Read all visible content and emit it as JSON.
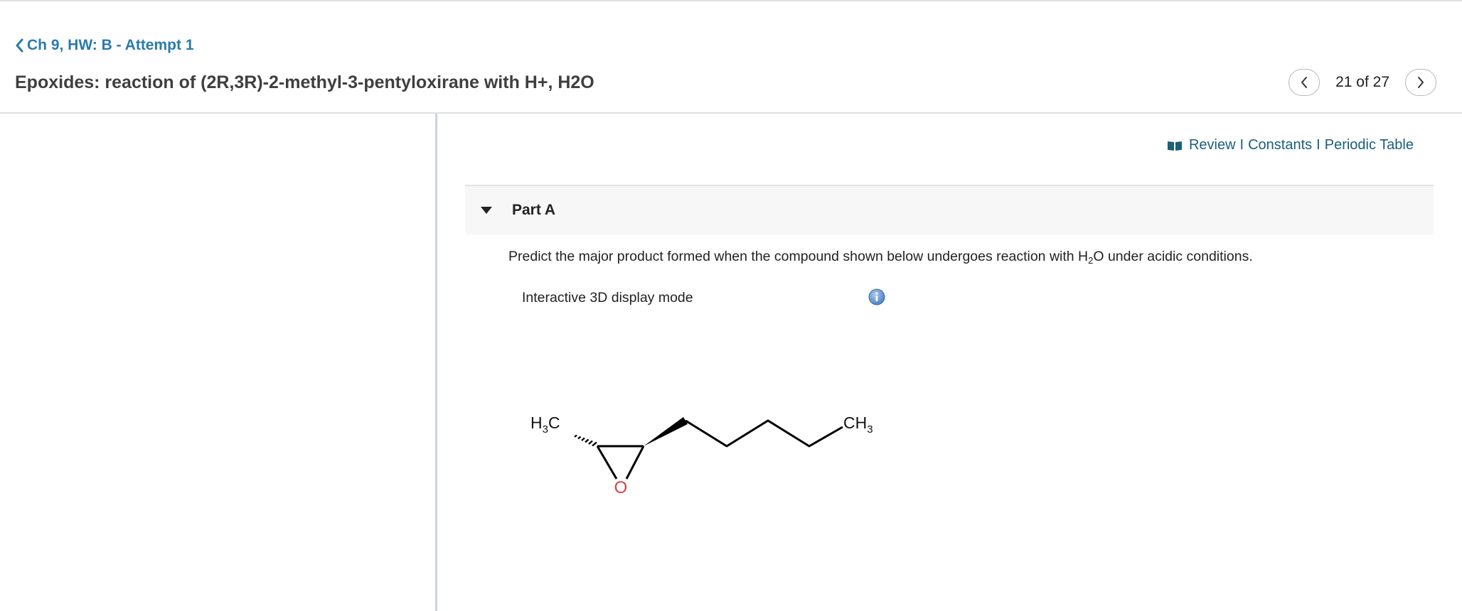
{
  "breadcrumb": {
    "back_label": "Ch 9, HW: B - Attempt 1"
  },
  "title": "Epoxides: reaction of (2R,3R)-2-methyl-3-pentyloxirane with H+, H2O",
  "pager": {
    "current": "21",
    "of_word": "of",
    "total": "27",
    "prev_icon": "chevron-left-icon",
    "next_icon": "chevron-right-icon"
  },
  "resources": {
    "review": "Review",
    "separator": "I",
    "constants": "Constants",
    "periodic_table": "Periodic Table",
    "icon": "book-icon"
  },
  "part": {
    "label": "Part A",
    "icon": "caret-down-icon"
  },
  "question": {
    "pre": "Predict the major product formed when the compound shown below undergoes reaction with H",
    "sub": "2",
    "post": "O under acidic conditions."
  },
  "display": {
    "mode_label": "Interactive 3D display mode",
    "info_icon": "info-icon"
  },
  "molecule": {
    "left_group": {
      "main": "H",
      "sub": "3",
      "tail": "C"
    },
    "right_group": {
      "main": "CH",
      "sub": "3"
    },
    "oxygen": "O"
  },
  "colors": {
    "link": "#2b7bab",
    "resource_link": "#1a5f7a",
    "oxygen": "#d9413b",
    "info": "#5b8fd1"
  }
}
